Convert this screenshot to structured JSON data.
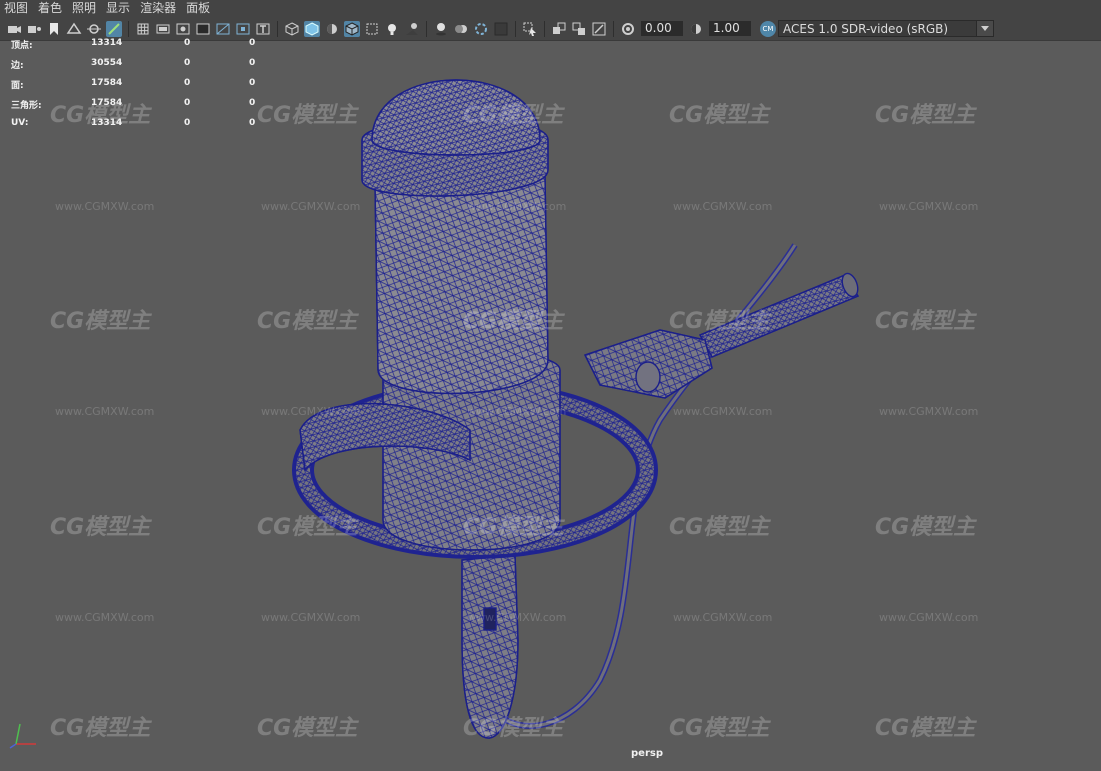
{
  "menu": [
    "视图",
    "着色",
    "照明",
    "显示",
    "渲染器",
    "面板"
  ],
  "toolbar": {
    "exposure_value": "0.00",
    "gamma_value": "1.00",
    "color_space": "ACES 1.0 SDR-video (sRGB)",
    "icons": [
      "select-camera-icon",
      "camera-attributes-icon",
      "bookmark-icon",
      "image-plane-icon",
      "2d-pan-zoom-icon",
      "grease-pencil-icon",
      "grid-icon",
      "film-gate-icon",
      "resolution-gate-icon",
      "gate-mask-icon",
      "field-chart-icon",
      "safe-action-icon",
      "safe-title-icon",
      "wireframe-icon",
      "smooth-shade-icon",
      "default-material-icon",
      "wireframe-on-shaded-icon",
      "xray-icon",
      "use-all-lights-icon",
      "shadows-icon",
      "screen-space-ao-icon",
      "motion-blur-icon",
      "multisample-aa-icon",
      "depth-of-field-icon",
      "isolate-select-icon",
      "xray-joints-icon",
      "xray-active-icon",
      "backface-culling-icon",
      "exposure-icon",
      "gamma-icon",
      "color-management-icon"
    ]
  },
  "hud": {
    "rows": [
      {
        "label": "顶点:",
        "c1": "13314",
        "c2": "0",
        "c3": "0"
      },
      {
        "label": "边:",
        "c1": "30554",
        "c2": "0",
        "c3": "0"
      },
      {
        "label": "面:",
        "c1": "17584",
        "c2": "0",
        "c3": "0"
      },
      {
        "label": "三角形:",
        "c1": "17584",
        "c2": "0",
        "c3": "0"
      },
      {
        "label": "UV:",
        "c1": "13314",
        "c2": "0",
        "c3": "0"
      }
    ]
  },
  "viewport": {
    "camera": "persp",
    "watermark_logo": "CG模型主",
    "watermark_url": "www.CGMXW.com",
    "wire_color": "#1b1f8a",
    "fill_color": "#7d7d85"
  },
  "axis": {
    "x_color": "#d13b3b",
    "y_color": "#4fbf4f",
    "z_color": "#4d63d6"
  }
}
